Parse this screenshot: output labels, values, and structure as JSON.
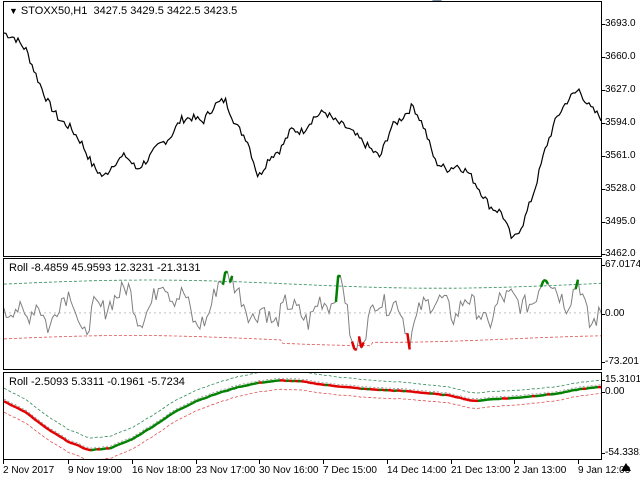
{
  "main_pane": {
    "symbol_title": "STOXX50,H1",
    "ohlc": "3427.5 3429.5 3422.5 3423.5",
    "price_ticks": [
      "3693.0",
      "3660.0",
      "3627.0",
      "3594.0",
      "3561.0",
      "3528.0",
      "3495.0",
      "3462.0"
    ]
  },
  "indicator1": {
    "title": "Roll -8.4859 45.9593 12.3231 -21.3131",
    "ticks": [
      "67.0174",
      "0.00",
      "-73.201"
    ]
  },
  "indicator2": {
    "title": "Roll -2.5093 5.3311 -0.1961 -5.7234",
    "ticks": [
      "15.3101",
      "0.00",
      "-54.3381"
    ]
  },
  "time_axis": [
    "2 Nov 2017",
    "9 Nov 19:00",
    "16 Nov 18:00",
    "23 Nov 17:00",
    "30 Nov 16:00",
    "7 Dec 15:00",
    "14 Dec 14:00",
    "21 Dec 13:00",
    "2 Jan 13:00",
    "9 Jan 12:00"
  ],
  "colors": {
    "up": "#008000",
    "down": "#e00000",
    "line": "#7f7f7f",
    "upper_band": "#2e8b57",
    "lower_band": "#e05050",
    "price": "#000000"
  },
  "chart_data": [
    {
      "type": "line",
      "title": "STOXX50,H1",
      "series": [
        {
          "values": [
            3685,
            3680,
            3668,
            3640,
            3615,
            3598,
            3590,
            3575,
            3552,
            3540,
            3555,
            3562,
            3548,
            3558,
            3572,
            3580,
            3598,
            3600,
            3596,
            3612,
            3618,
            3592,
            3578,
            3540,
            3560,
            3568,
            3588,
            3586,
            3600,
            3606,
            3596,
            3590,
            3580,
            3570,
            3560,
            3590,
            3600,
            3612,
            3590,
            3556,
            3548,
            3552,
            3545,
            3528,
            3510,
            3505,
            3476,
            3495,
            3528,
            3570,
            3600,
            3618,
            3628,
            3610,
            3600
          ]
        }
      ],
      "ylim": [
        3462,
        3693
      ]
    },
    {
      "type": "line",
      "title": "Roll",
      "series": [
        {
          "values": [
            -5,
            10,
            -8,
            15,
            -25,
            20,
            30,
            -40,
            10,
            5,
            25,
            40,
            -15,
            10,
            52,
            20,
            30,
            -20,
            -10,
            45,
            55,
            25,
            -10,
            10,
            -20,
            15,
            5,
            -15,
            20,
            10,
            55,
            -60,
            -30,
            20,
            10,
            15,
            -40,
            10,
            15,
            20,
            -10,
            25,
            5,
            -20,
            20,
            25,
            10,
            15,
            60,
            35,
            10,
            50,
            -20,
            0
          ]
        }
      ],
      "ylim": [
        -73.201,
        67.0174
      ]
    },
    {
      "type": "line",
      "title": "Roll",
      "series": [
        {
          "values": [
            -5,
            -15,
            -30,
            -42,
            -50,
            -48,
            -40,
            -28,
            -15,
            -5,
            2,
            8,
            12,
            14,
            13,
            10,
            8,
            6,
            5,
            4,
            2,
            0,
            -5,
            -3,
            -2,
            0,
            2,
            6,
            8
          ]
        }
      ],
      "ylim": [
        -54.3381,
        15.3101
      ]
    }
  ]
}
